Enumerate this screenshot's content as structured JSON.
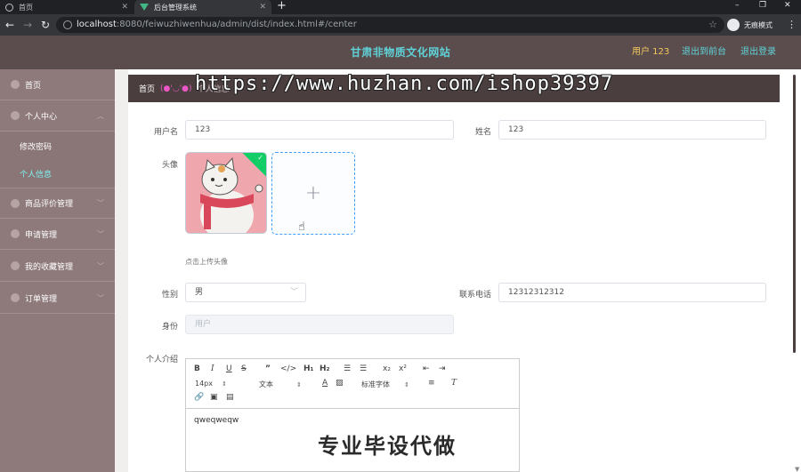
{
  "browser": {
    "tabs": [
      {
        "title": "首页",
        "active": false
      },
      {
        "title": "后台管理系统",
        "active": true
      }
    ],
    "url_host": "localhost",
    "url_rest": ":8080/feiwuzhiwenhua/admin/dist/index.html#/center",
    "incognito_label": "无痕模式"
  },
  "header": {
    "site_title": "甘肃非物质文化网站",
    "user": "用户 123",
    "back_to_front": "退出到前台",
    "logout": "退出登录"
  },
  "sidebar": {
    "items": [
      {
        "label": "首页"
      },
      {
        "label": "个人中心"
      },
      {
        "label": "修改密码"
      },
      {
        "label": "个人信息"
      },
      {
        "label": "商品评价管理"
      },
      {
        "label": "申请管理"
      },
      {
        "label": "我的收藏管理"
      },
      {
        "label": "订单管理"
      }
    ]
  },
  "breadcrumb": {
    "home": "首页",
    "emoticon": "(●'◡'●)",
    "current": "个人信息"
  },
  "form": {
    "username_label": "用户名",
    "username_value": "123",
    "name_label": "姓名",
    "name_value": "123",
    "avatar_label": "头像",
    "upload_hint": "点击上传头像",
    "gender_label": "性别",
    "gender_value": "男",
    "phone_label": "联系电话",
    "phone_value": "12312312312",
    "identity_label": "身份",
    "identity_placeholder": "用户",
    "intro_label": "个人介绍",
    "intro_value": "qweqweqw"
  },
  "editor": {
    "font_size": "14px",
    "text_style": "文本",
    "font_family": "标准字体"
  },
  "overlay": {
    "watermark": "https://www.huzhan.com/ishop39397",
    "stamp": "专业毕设代做"
  },
  "colors": {
    "header_bg": "#5b4d4d",
    "sidebar_bg": "#8e7a7b",
    "accent_cyan": "#5fd3d8",
    "accent_yellow": "#f3c85d"
  }
}
